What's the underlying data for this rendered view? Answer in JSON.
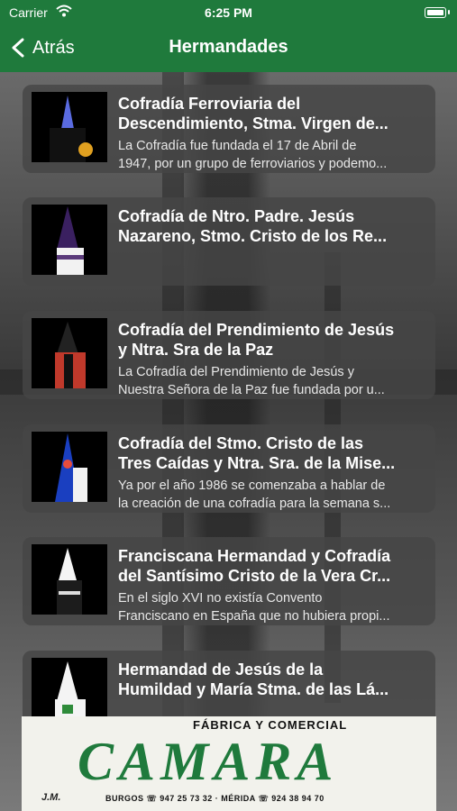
{
  "status_bar": {
    "carrier": "Carrier",
    "time": "6:25 PM"
  },
  "nav": {
    "back_label": "Atrás",
    "title": "Hermandades"
  },
  "items": [
    {
      "title": "Cofradía Ferroviaria del\nDescendimiento, Stma. Virgen de...",
      "description": "La Cofradía fue fundada el 17 de Abril de\n1947, por un grupo de ferroviarios y podemo...",
      "image": "nazareno-blue-hood"
    },
    {
      "title": "Cofradía de Ntro. Padre. Jesús\nNazareno, Stmo. Cristo de los Re...",
      "description": "",
      "image": "nazareno-purple-hood"
    },
    {
      "title": "Cofradía del Prendimiento de Jesús\ny Ntra. Sra de la Paz",
      "description": "La Cofradía del Prendimiento de Jesús y\nNuestra Señora de la Paz fue fundada por u...",
      "image": "nazareno-red-robe"
    },
    {
      "title": "Cofradía del Stmo. Cristo de las\nTres Caídas y Ntra. Sra. de la Mise...",
      "description": "Ya por el año 1986 se comenzaba a hablar de\nla creación de una cofradía para la semana s...",
      "image": "nazareno-blue-white"
    },
    {
      "title": "Franciscana Hermandad y Cofradía\ndel Santísimo Cristo de la Vera Cr...",
      "description": "En el siglo XVI no existía Convento\nFranciscano en España que no hubiera propi...",
      "image": "nazareno-white-hood"
    },
    {
      "title": "Hermandad de Jesús de la\nHumildad y María Stma. de las Lá...",
      "description": "",
      "image": "nazareno-white-green"
    }
  ],
  "ad": {
    "top_text": "FÁBRICA  Y  COMERCIAL",
    "brand": "CAMARA",
    "initials": "J.M.",
    "contact": "BURGOS ☏ 947 25 73 32  ·  MÉRIDA ☏ 924 38 94 70"
  },
  "colors": {
    "nav_green": "#1f7a3c",
    "card_bg": "#464646"
  }
}
